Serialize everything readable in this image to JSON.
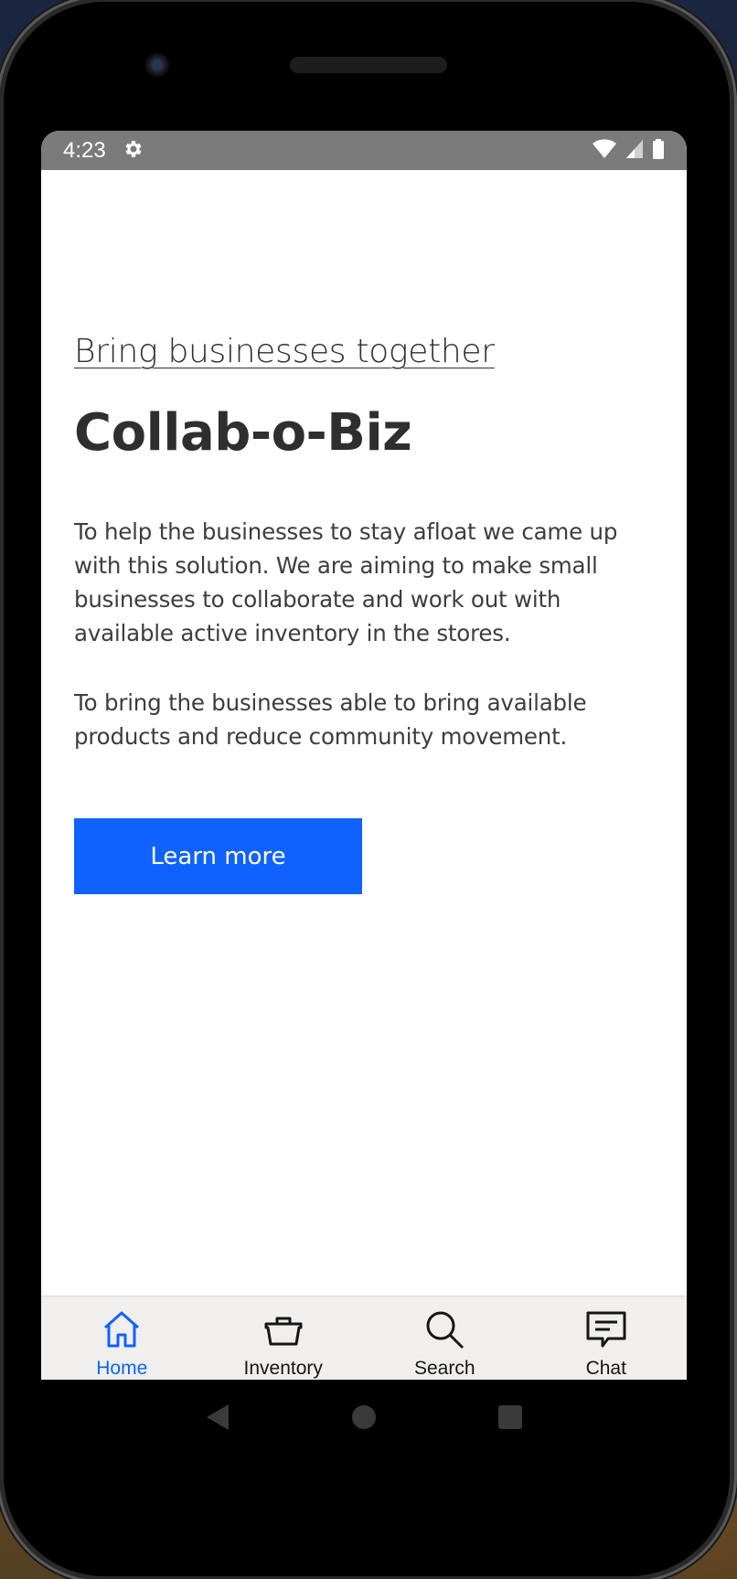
{
  "status_bar": {
    "time": "4:23",
    "icons": [
      "gear-icon",
      "wifi-icon",
      "signal-icon",
      "battery-icon"
    ]
  },
  "hero": {
    "subtitle": "Bring businesses together",
    "title": "Collab-o-Biz",
    "paragraph_1": "To help the businesses to stay afloat we came up with this solution. We are aiming to make small businesses to collaborate and work out with available active inventory in the stores.",
    "paragraph_2": "To bring the businesses able to bring available products and reduce community movement.",
    "cta_label": "Learn more"
  },
  "bottom_nav": {
    "items": [
      {
        "label": "Home",
        "icon": "home-icon",
        "active": true
      },
      {
        "label": "Inventory",
        "icon": "basket-icon",
        "active": false
      },
      {
        "label": "Search",
        "icon": "search-icon",
        "active": false
      },
      {
        "label": "Chat",
        "icon": "chat-icon",
        "active": false
      }
    ]
  },
  "system_nav": {
    "buttons": [
      "back-icon",
      "home-circle-icon",
      "recents-icon"
    ]
  },
  "colors": {
    "accent": "#0f62fe",
    "status_bar": "#7b7b7b",
    "text": "#393939",
    "nav_background": "#f0efee"
  }
}
